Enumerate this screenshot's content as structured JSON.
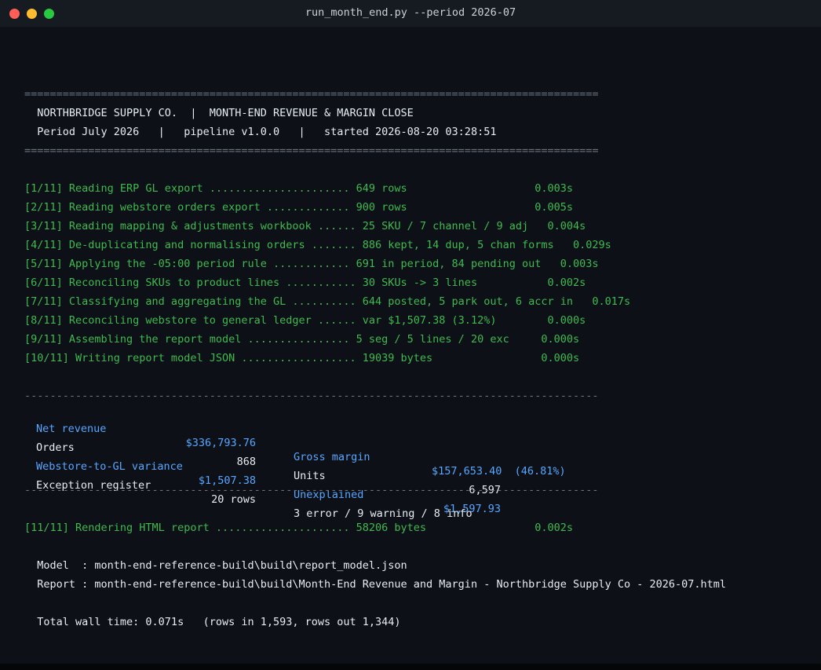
{
  "window": {
    "title": "run_month_end.py --period 2026-07"
  },
  "header": {
    "rule": "==========================================================================================",
    "line1": "  NORTHBRIDGE SUPPLY CO.  |  MONTH-END REVENUE & MARGIN CLOSE",
    "line2": "  Period July 2026   |   pipeline v1.0.0   |   started 2026-08-20 03:28:51"
  },
  "steps": [
    "[1/11] Reading ERP GL export ...................... 649 rows                    0.003s",
    "[2/11] Reading webstore orders export ............. 900 rows                    0.005s",
    "[3/11] Reading mapping & adjustments workbook ...... 25 SKU / 7 channel / 9 adj   0.004s",
    "[4/11] De-duplicating and normalising orders ....... 886 kept, 14 dup, 5 chan forms   0.029s",
    "[5/11] Applying the -05:00 period rule ............ 691 in period, 84 pending out   0.003s",
    "[6/11] Reconciling SKUs to product lines ........... 30 SKUs -> 3 lines           0.002s",
    "[7/11] Classifying and aggregating the GL .......... 644 posted, 5 park out, 6 accr in   0.017s",
    "[8/11] Reconciling webstore to general ledger ...... var $1,507.38 (3.12%)        0.000s",
    "[9/11] Assembling the report model ................ 5 seg / 5 lines / 20 exc     0.000s",
    "[10/11] Writing report model JSON .................. 19039 bytes                 0.000s"
  ],
  "summary": {
    "rule": "------------------------------------------------------------------------------------------",
    "rows": [
      {
        "label": "Net revenue",
        "value": "$336,793.76",
        "label2": "Gross margin",
        "value2": "$157,653.40  (46.81%)",
        "highlight": true
      },
      {
        "label": "Orders",
        "value": "868",
        "label2": "Units",
        "value2": "6,597",
        "highlight": false
      },
      {
        "label": "Webstore-to-GL variance",
        "value": "$1,507.38",
        "label2": "Unexplained",
        "value2": "$1,597.93",
        "highlight": true
      },
      {
        "label": "Exception register",
        "value": "20 rows",
        "label2": "3 error / 9 warning / 8 info",
        "value2": "",
        "highlight": false
      }
    ]
  },
  "render_step": "[11/11] Rendering HTML report ..................... 58206 bytes                 0.002s",
  "outputs": {
    "model_line": "  Model  : month-end-reference-build\\build\\report_model.json",
    "report_line": "  Report : month-end-reference-build\\build\\Month-End Revenue and Margin - Northbridge Supply Co - 2026-07.html"
  },
  "footer": {
    "wall_time": "  Total wall time: 0.071s   (rows in 1,593, rows out 1,344)"
  },
  "colors": {
    "background": "#0d1117",
    "step_green": "#3fb950",
    "accent_blue": "#58a6ff",
    "text": "#e6edf3",
    "rule": "#6b7380"
  }
}
